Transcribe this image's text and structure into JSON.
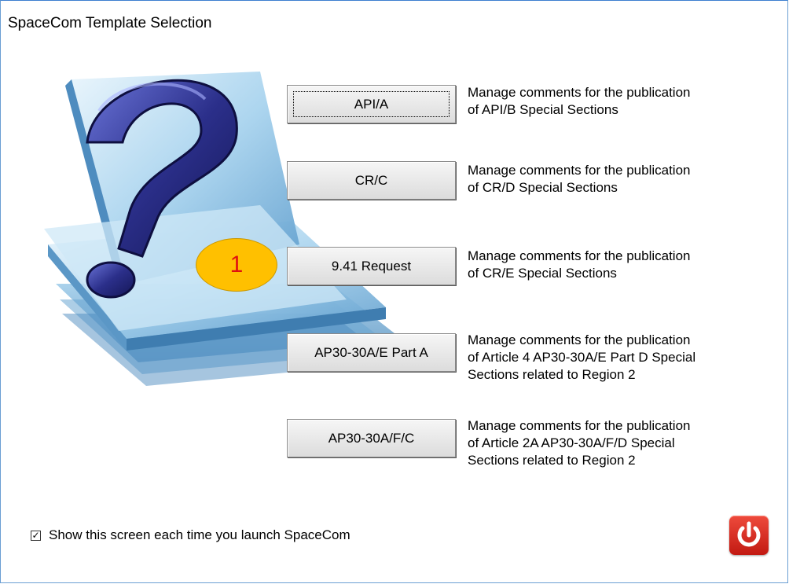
{
  "window": {
    "title": "SpaceCom Template Selection"
  },
  "templates": [
    {
      "label": "API/A",
      "description": [
        "Manage comments for the publication",
        "of API/B Special Sections"
      ]
    },
    {
      "label": "CR/C",
      "description": [
        "Manage comments for the publication",
        "of CR/D Special Sections"
      ]
    },
    {
      "label": "9.41 Request",
      "description": [
        "Manage comments for the publication",
        "of CR/E Special Sections"
      ]
    },
    {
      "label": "AP30-30A/E Part A",
      "description": [
        "Manage comments for the publication",
        "of Article 4 AP30-30A/E Part D Special",
        "Sections related to Region 2"
      ]
    },
    {
      "label": "AP30-30A/F/C",
      "description": [
        "Manage comments for the publication",
        "of Article 2A AP30-30A/F/D Special",
        "Sections related to Region 2"
      ]
    }
  ],
  "annotation": {
    "badge_text": "1"
  },
  "footer": {
    "checkbox_label": "Show this screen each time you launch SpaceCom",
    "checkbox_checked": true
  },
  "icons": {
    "illustration": "question-mark-stack-icon",
    "exit": "power-icon",
    "check": "checkmark-icon"
  },
  "colors": {
    "badge_fill": "#ffc000",
    "badge_text": "#e01010",
    "power_button": "#d42a20",
    "question_mark": "#2a2f8a",
    "folder_blue": "#7fb6dc"
  }
}
